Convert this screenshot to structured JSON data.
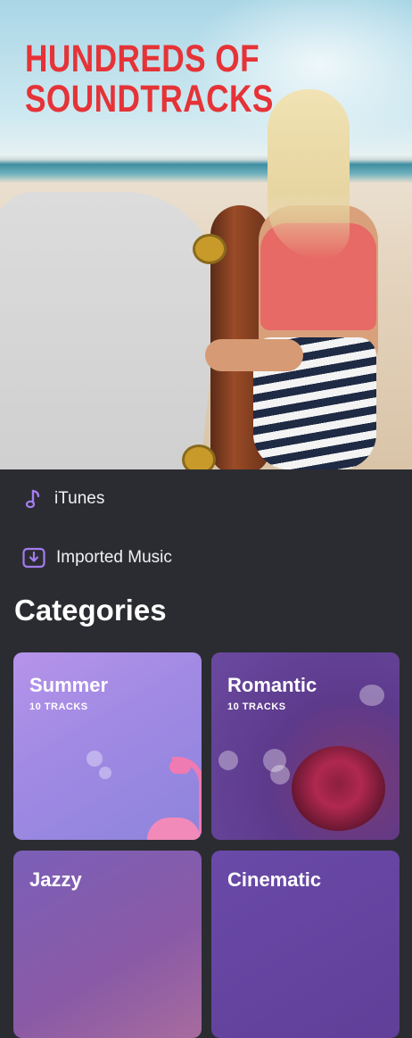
{
  "hero": {
    "title_line1": "HUNDREDS OF",
    "title_line2": "SOUNDTRACKS",
    "title_color": "#e53337"
  },
  "sources": [
    {
      "label": "iTunes",
      "icon": "music-note-icon"
    },
    {
      "label": "Imported Music",
      "icon": "download-icon"
    }
  ],
  "accent_color": "#a37cf0",
  "categories_title": "Categories",
  "categories": [
    {
      "title": "Summer",
      "subtitle": "10 TRACKS"
    },
    {
      "title": "Romantic",
      "subtitle": "10 TRACKS"
    },
    {
      "title": "Jazzy"
    },
    {
      "title": "Cinematic"
    }
  ]
}
